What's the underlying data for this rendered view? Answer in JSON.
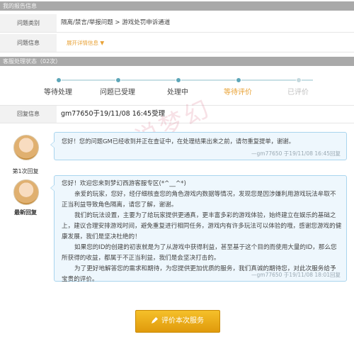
{
  "sections": {
    "basic_info_title": "我的报告信息",
    "processing_title": "客服处理状态（02次）"
  },
  "fields": {
    "problem_type_label": "问题类别",
    "problem_type_value": "隔离/禁言/举报问题 > 游戏处罚申诉通道",
    "problem_info_label": "问题信息",
    "problem_info_link": "展开详情信息 ▼",
    "reply_info_label": "回复信息",
    "reply_info_value": "gm77650于19/11/08 16:45受理"
  },
  "steps": [
    {
      "label": "等待处理",
      "state": "done"
    },
    {
      "label": "问题已受理",
      "state": "done"
    },
    {
      "label": "处理中",
      "state": "done"
    },
    {
      "label": "等待评价",
      "state": "current"
    },
    {
      "label": "已评价",
      "state": "pending"
    }
  ],
  "replies": [
    {
      "caption": "第1次回复",
      "text": "您好！您的问题GM已经收到并正在查证中，在处理结果出来之前，请勿重复提单，谢谢。",
      "signature": "—gm77650 于19/11/08 16:45回复"
    },
    {
      "caption": "最新回复",
      "greeting": "您好！欢迎您来到梦幻西游客服专区(*^__^*)",
      "paragraphs": [
        "亲爱的玩家，您好，经仔细核查您的角色游戏内数据等情况，发现您是因涉嫌利用游戏玩法牟取不正当利益导致角色隔离，请您了解，谢谢。",
        "我们的玩法设置，主要为了给玩家提供更通真，更丰富多彩的游戏体验，始终建立在娱乐的基础之上，建议合理安排游戏时间，避免重复进行相同任务，游戏内有许多玩法可以体验的哦，感谢您游戏的健康发展，我们是坚决杜绝的！",
        "如果您的ID的创建的初衷就是为了从游戏中获得利益，甚至基于这个目的而使用大量的ID，那么您所获得的收益，都属于不正当利益，我们是会坚决打击的。",
        "为了更好地解答您的需求和期待，为您提供更加优质的服务，我们真诚的期待您，对此次服务给予宝贵的评价。"
      ],
      "signature": "—gm77650 于19/11/08 18:01回复"
    }
  ],
  "actions": {
    "rate_button": "评价本次服务"
  },
  "watermark": "梦说梦幻"
}
